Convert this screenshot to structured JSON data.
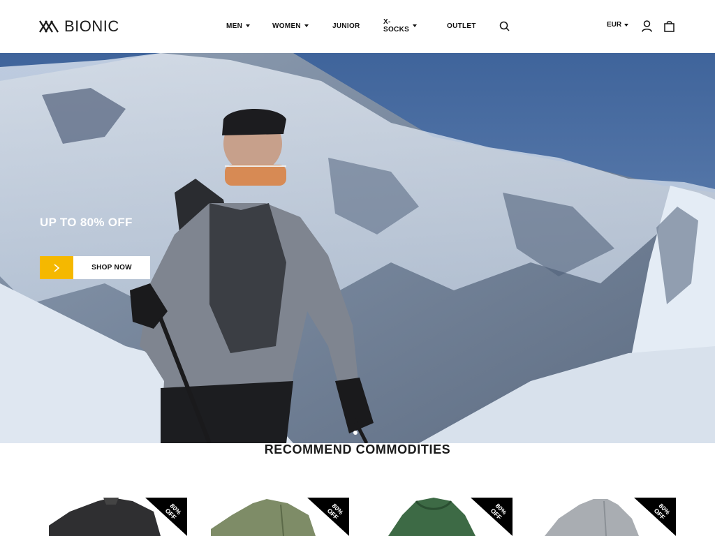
{
  "brand": {
    "name": "BIONIC"
  },
  "nav": {
    "items": [
      {
        "label": "MEN",
        "has_dropdown": true
      },
      {
        "label": "WOMEN",
        "has_dropdown": true
      },
      {
        "label": "JUNIOR",
        "has_dropdown": false
      },
      {
        "label": "X-SOCKS",
        "has_dropdown": true
      },
      {
        "label": "OUTLET",
        "has_dropdown": false
      }
    ],
    "currency": "EUR"
  },
  "icons": {
    "search": "search-icon",
    "account": "user-icon",
    "cart": "shopping-bag-icon",
    "shop_arrow": "chevron-right-icon"
  },
  "hero": {
    "headline": "UP TO 80% OFF",
    "cta_label": "SHOP NOW",
    "slides": 2,
    "active_slide": 1
  },
  "section": {
    "title": "RECOMMEND COMMODITIES"
  },
  "products": [
    {
      "badge": "80% OFF",
      "color": "#2f2f31"
    },
    {
      "badge": "80% OFF",
      "color": "#7e8c67"
    },
    {
      "badge": "80% OFF",
      "color": "#3d6a45"
    },
    {
      "badge": "80% OFF",
      "color": "#a9adb2"
    }
  ],
  "colors": {
    "accent": "#f5b800",
    "text": "#111111",
    "badge_bg": "#000000"
  }
}
